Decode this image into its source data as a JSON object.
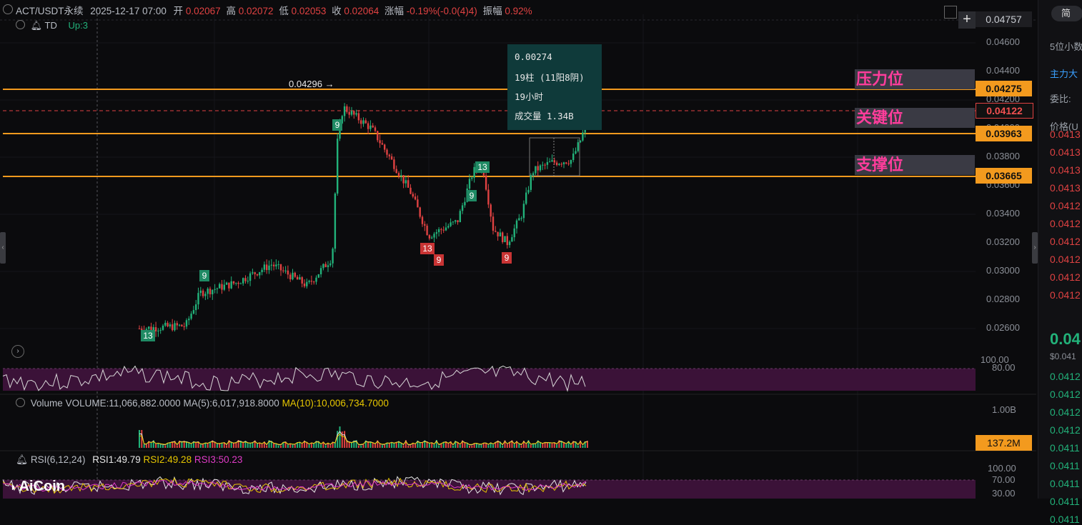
{
  "header": {
    "symbol": "ACT/USDT永续",
    "datetime": "2025-12-17 07:00",
    "open_label": "开",
    "open": "0.02067",
    "high_label": "高",
    "high": "0.02072",
    "low_label": "低",
    "low": "0.02053",
    "close_label": "收",
    "close": "0.02064",
    "change_label": "涨幅",
    "change": "-0.19%(-0.0(4)4)",
    "amp_label": "振幅",
    "amp": "0.92%"
  },
  "indicator": {
    "name": "TD",
    "status": "Up:3"
  },
  "price_axis": [
    "0.04600",
    "0.04400",
    "0.04200",
    "0.04000",
    "0.03800",
    "0.03600",
    "0.03400",
    "0.03200",
    "0.03000",
    "0.02800",
    "0.02600"
  ],
  "price_tags": {
    "top": "0.04757",
    "pressure": "0.04275",
    "current": "0.04122",
    "key": "0.03963",
    "support": "0.03665",
    "volume": "137.2M"
  },
  "zones": {
    "pressure": "压力位",
    "key": "关键位",
    "support": "支撑位"
  },
  "peak_label": "0.04296 →",
  "tooltip": {
    "diff": "0.00274",
    "bars": "19柱 (11阳8阴)",
    "hours": "19小时",
    "volume": "成交量 1.34B"
  },
  "td_counts": [
    "13",
    "9",
    "9",
    "13",
    "9",
    "9",
    "13",
    "9",
    "9"
  ],
  "osc_axis": {
    "top": "100.00",
    "mid": "80.00"
  },
  "volume": {
    "label": "Volume",
    "value": "VOLUME:11,066,882.0000",
    "ma5": "MA(5):6,017,918.8000",
    "ma10": "MA(10):10,006,734.7000",
    "axis": "1.00B"
  },
  "rsi": {
    "label": "RSI(6,12,24)",
    "rsi1": "RSI1:49.79",
    "rsi2": "RSI2:49.28",
    "rsi3": "RSI3:50.23",
    "axis": [
      "100.00",
      "70.00",
      "30.00"
    ]
  },
  "logo": "AiCoin",
  "sidebar": {
    "top": "简",
    "label1": "5位小数",
    "label2": "主力大",
    "label3": "委比:",
    "label4": "价格(U",
    "asks": [
      "0.0413",
      "0.0413",
      "0.0413",
      "0.0413",
      "0.0412",
      "0.0412",
      "0.0412",
      "0.0412",
      "0.0412",
      "0.0412"
    ],
    "last": "0.04",
    "last_usd": "$0.041",
    "bids": [
      "0.0412",
      "0.0412",
      "0.0412",
      "0.0412",
      "0.0411",
      "0.0411",
      "0.0411",
      "0.0411",
      "0.0411"
    ]
  },
  "colors": {
    "up": "#22b27a",
    "down": "#e04242",
    "orange": "#f39a1e",
    "magenta": "#ff3d9c"
  }
}
